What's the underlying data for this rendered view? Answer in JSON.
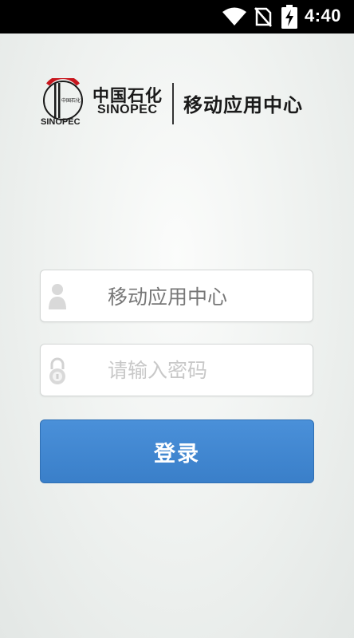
{
  "status_bar": {
    "time": "4:40",
    "icons": [
      "wifi-icon",
      "no-sim-icon",
      "battery-charging-icon"
    ]
  },
  "header": {
    "brand_cn": "中国石化",
    "brand_en": "SINOPEC",
    "logo_text": "中国石化",
    "logo_letters": "SINOPEC",
    "app_title": "移动应用中心"
  },
  "form": {
    "username_value": "移动应用中心",
    "username_icon": "user-icon",
    "password_placeholder": "请输入密码",
    "password_icon": "lock-icon",
    "login_label": "登录"
  },
  "colors": {
    "button": "#3f86d1",
    "status_bar": "#000000",
    "background": "#eef1ef"
  }
}
